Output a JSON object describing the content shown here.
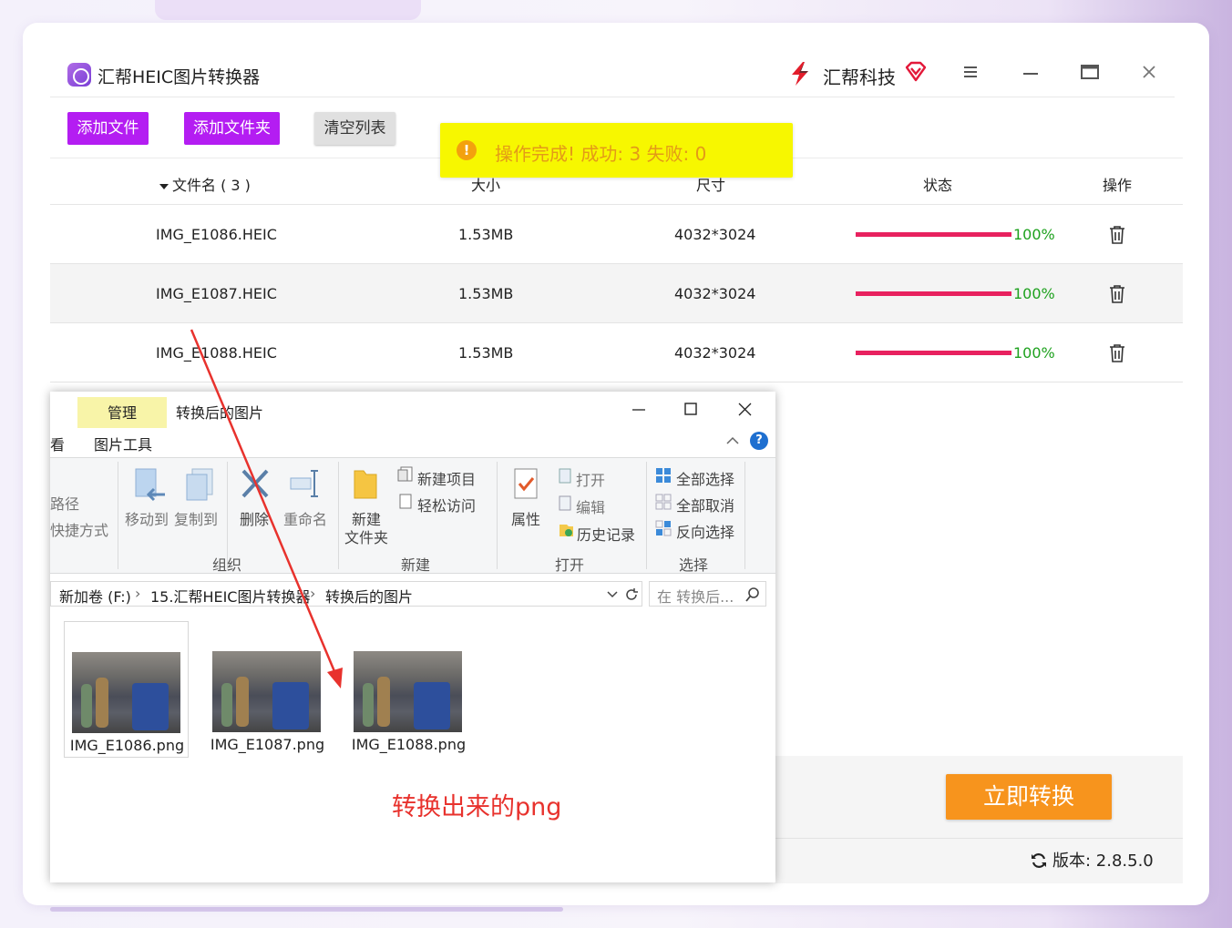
{
  "app": {
    "title": "汇帮HEIC图片转换器",
    "brand": "汇帮科技",
    "colors": {
      "accent": "#b41df2",
      "progress": "#e8215f",
      "success": "#1ea11e",
      "convert": "#f7941d",
      "toast_bg": "#f7f700",
      "toast_text": "#e39a18"
    }
  },
  "toolbar": {
    "add_file": "添加文件",
    "add_folder": "添加文件夹",
    "clear_list": "清空列表"
  },
  "toast": {
    "icon": "info-icon",
    "message": "操作完成!   成功: 3     失败: 0"
  },
  "table": {
    "headers": {
      "name": "文件名 ( 3 )",
      "size": "大小",
      "dim": "尺寸",
      "status": "状态",
      "action": "操作"
    },
    "rows": [
      {
        "name": "IMG_E1086.HEIC",
        "size": "1.53MB",
        "dim": "4032*3024",
        "progress": 1.0,
        "pct": "100%"
      },
      {
        "name": "IMG_E1087.HEIC",
        "size": "1.53MB",
        "dim": "4032*3024",
        "progress": 1.0,
        "pct": "100%"
      },
      {
        "name": "IMG_E1088.HEIC",
        "size": "1.53MB",
        "dim": "4032*3024",
        "progress": 1.0,
        "pct": "100%"
      }
    ]
  },
  "footer": {
    "convert_button": "立即转换",
    "version": "版本:  2.8.5.0"
  },
  "explorer": {
    "tab_manage": "管理",
    "title": "转换后的图片",
    "tab_view": "看",
    "tab_tools": "图片工具",
    "ribbon": {
      "path": "路径",
      "shortcut": "快捷方式",
      "move_to": "移动到",
      "copy_to": "复制到",
      "delete": "删除",
      "rename": "重命名",
      "group_organize": "组织",
      "new_folder_1": "新建",
      "new_folder_2": "文件夹",
      "new_item": "新建项目",
      "easy_access": "轻松访问",
      "group_new": "新建",
      "properties": "属性",
      "open": "打开",
      "edit": "编辑",
      "history": "历史记录",
      "group_open": "打开",
      "select_all": "全部选择",
      "select_none": "全部取消",
      "invert": "反向选择",
      "group_select": "选择"
    },
    "address": {
      "drive": "新加卷 (F:)",
      "folder1": "15.汇帮HEIC图片转换器",
      "folder2": "转换后的图片"
    },
    "search_placeholder": "在 转换后...",
    "files": [
      "IMG_E1086.png",
      "IMG_E1087.png",
      "IMG_E1088.png"
    ],
    "caption": "转换出来的png"
  }
}
